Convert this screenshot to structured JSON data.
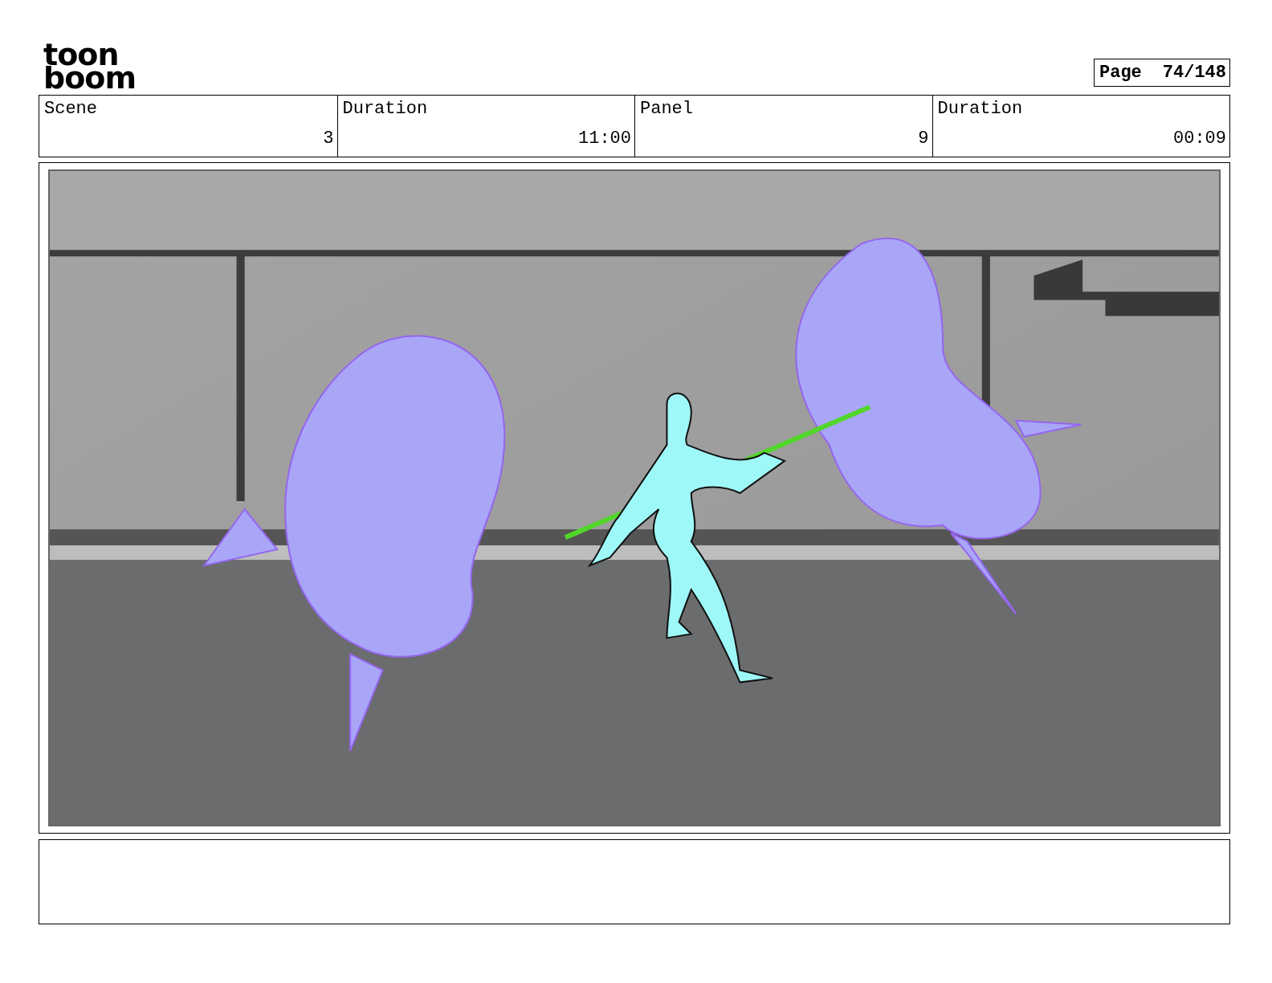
{
  "logo": [
    "toon",
    "boom"
  ],
  "page": {
    "label": "Page",
    "value": "74/148"
  },
  "info_table": {
    "columns": [
      "Scene",
      "Duration",
      "Panel",
      "Duration"
    ],
    "rows": [
      [
        "3",
        "11:00",
        "9",
        "00:09"
      ]
    ]
  }
}
